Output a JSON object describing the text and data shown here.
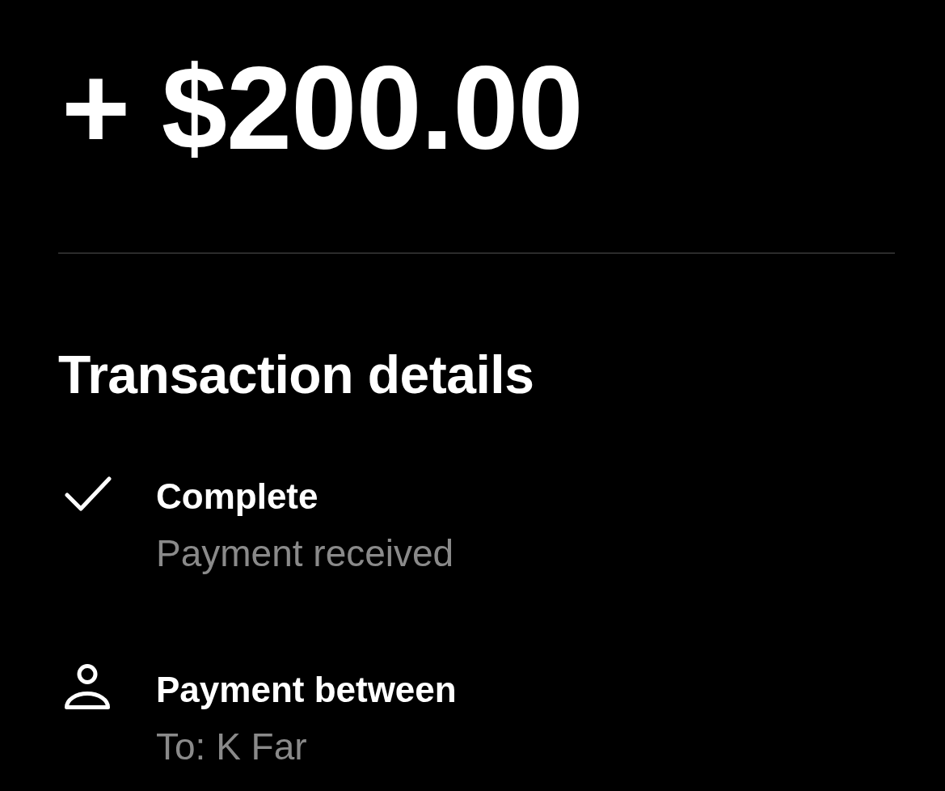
{
  "amount": "+ $200.00",
  "section_title": "Transaction details",
  "details": [
    {
      "kind": "status",
      "title": "Complete",
      "subtitle": "Payment received"
    },
    {
      "kind": "person",
      "title": "Payment between",
      "subtitle": "To: K Far"
    }
  ]
}
